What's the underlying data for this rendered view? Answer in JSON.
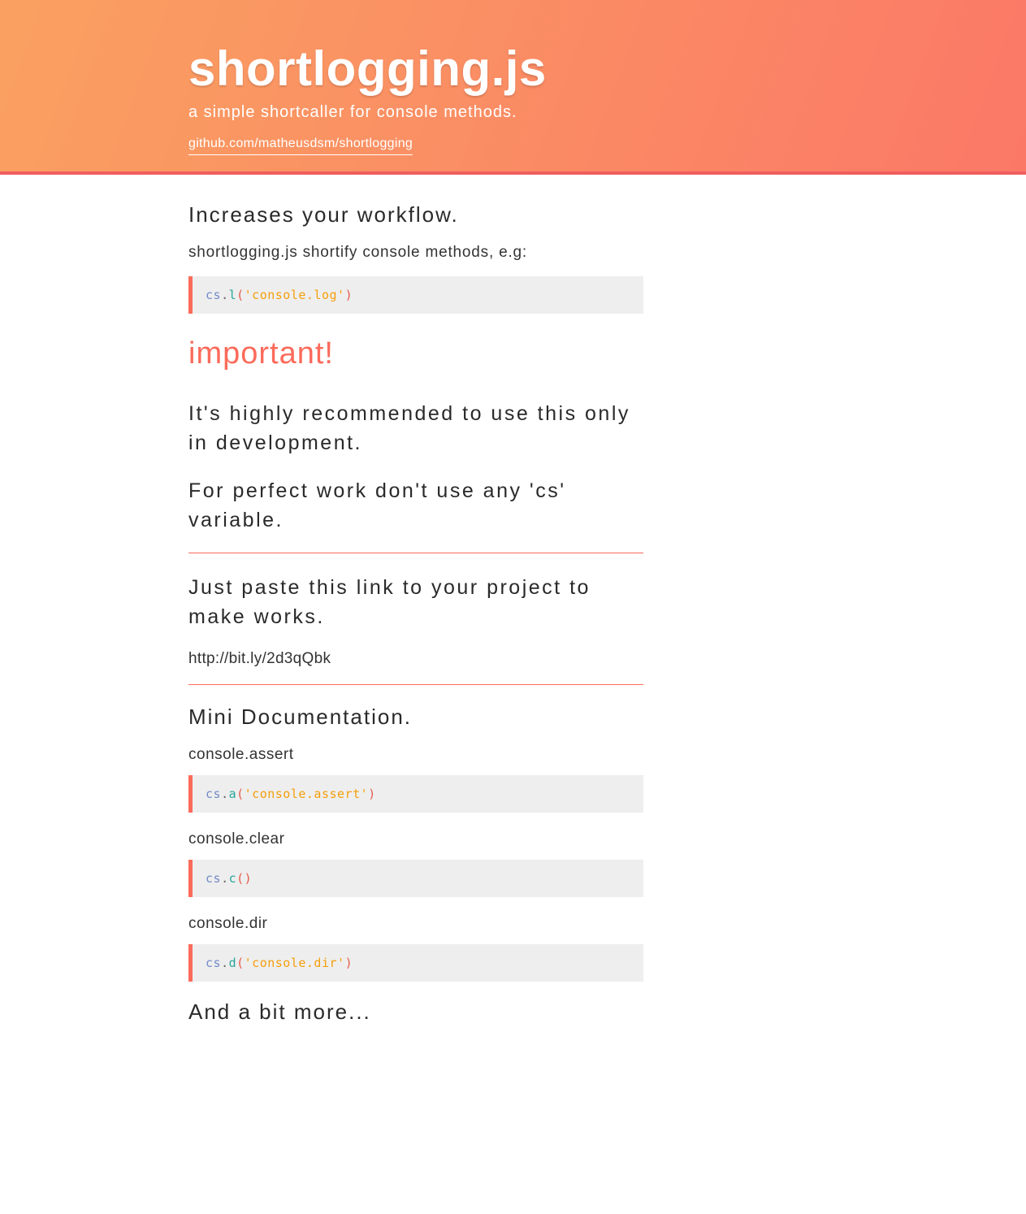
{
  "header": {
    "title": "shortlogging.js",
    "subtitle": "a simple shortcaller for console methods.",
    "github_link": "github.com/matheusdsm/shortlogging"
  },
  "intro": {
    "heading": "Increases your workflow.",
    "desc": "shortlogging.js shortify console methods, e.g:",
    "code": {
      "obj": "cs",
      "dot": ".",
      "fn": "l",
      "open": "(",
      "str": "'console.log'",
      "close": ")"
    }
  },
  "important": {
    "heading": "important!",
    "line1": "It's highly recommended to use this only in development.",
    "line2": "For perfect work don't use any 'cs' variable."
  },
  "install": {
    "heading": "Just paste this link to your project to make works.",
    "link": "http://bit.ly/2d3qQbk"
  },
  "docs": {
    "heading": "Mini Documentation.",
    "items": [
      {
        "label": "console.assert",
        "obj": "cs",
        "fn": "a",
        "str": "'console.assert'",
        "has_arg": true
      },
      {
        "label": "console.clear",
        "obj": "cs",
        "fn": "c",
        "str": "",
        "has_arg": false
      },
      {
        "label": "console.dir",
        "obj": "cs",
        "fn": "d",
        "str": "'console.dir'",
        "has_arg": true
      }
    ],
    "more": "And a bit more..."
  }
}
